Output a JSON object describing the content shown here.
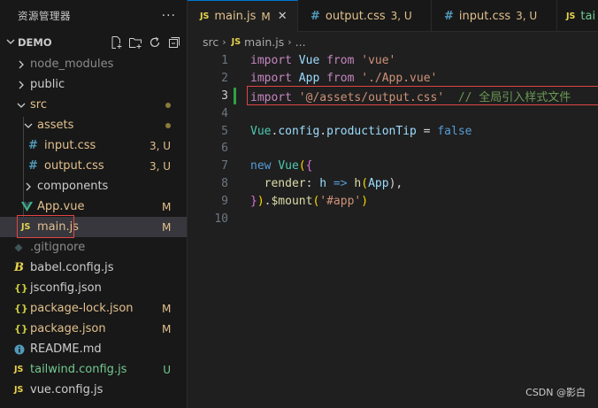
{
  "sidebar": {
    "title": "资源管理器",
    "more_label": "···",
    "workspace": "DEMO",
    "items": [
      {
        "name": "node_modules",
        "type": "folder",
        "state": "collapsed",
        "color": "gray"
      },
      {
        "name": "public",
        "type": "folder",
        "state": "collapsed",
        "color": "white"
      },
      {
        "name": "src",
        "type": "folder",
        "state": "expanded",
        "color": "modified",
        "dot": true
      },
      {
        "name": "assets",
        "type": "folder",
        "state": "expanded",
        "color": "modified",
        "dot": true
      },
      {
        "name": "input.css",
        "type": "css",
        "color": "modified",
        "badge": "3, U"
      },
      {
        "name": "output.css",
        "type": "css",
        "color": "modified",
        "badge": "3, U"
      },
      {
        "name": "components",
        "type": "folder",
        "state": "collapsed",
        "color": "white"
      },
      {
        "name": "App.vue",
        "type": "vue",
        "color": "modified",
        "badge": "M"
      },
      {
        "name": "main.js",
        "type": "js",
        "color": "modified",
        "badge": "M",
        "selected": true
      },
      {
        "name": ".gitignore",
        "type": "git",
        "color": "gray"
      },
      {
        "name": "babel.config.js",
        "type": "babel",
        "color": "white"
      },
      {
        "name": "jsconfig.json",
        "type": "json",
        "color": "white"
      },
      {
        "name": "package-lock.json",
        "type": "json",
        "color": "modified",
        "badge": "M"
      },
      {
        "name": "package.json",
        "type": "json",
        "color": "modified",
        "badge": "M"
      },
      {
        "name": "README.md",
        "type": "info",
        "color": "white"
      },
      {
        "name": "tailwind.config.js",
        "type": "js",
        "color": "untracked",
        "badge": "U"
      },
      {
        "name": "vue.config.js",
        "type": "js",
        "color": "white"
      }
    ]
  },
  "tabs": [
    {
      "icon": "JS",
      "label": "main.js",
      "status": "M",
      "close": "✕",
      "active": true
    },
    {
      "icon": "#",
      "label": "output.css",
      "status": "3, U",
      "active": false
    },
    {
      "icon": "#",
      "label": "input.css",
      "status": "3, U",
      "active": false
    },
    {
      "icon": "JS",
      "label": "tai",
      "status": "",
      "active": false
    }
  ],
  "breadcrumb": [
    "src",
    "main.js",
    "..."
  ],
  "code": {
    "current_line": 3,
    "line_numbers": [
      "1",
      "2",
      "3",
      "4",
      "5",
      "6",
      "7",
      "8",
      "9",
      "10"
    ],
    "l1": [
      "import",
      "Vue",
      "from",
      "'vue'"
    ],
    "l2": [
      "import",
      "App",
      "from",
      "'./App.vue'"
    ],
    "l3": [
      "import",
      "'@/assets/output.css'",
      "// 全局引入样式文件"
    ],
    "l5": [
      "Vue",
      ".",
      "config",
      ".",
      "productionTip",
      " = ",
      "false"
    ],
    "l7": [
      "new",
      "Vue",
      "(",
      "{"
    ],
    "l8": [
      "render",
      ": ",
      "h",
      " => ",
      "h",
      "(",
      "App",
      "),"
    ],
    "l9": [
      "}",
      ")",
      ".",
      "$mount",
      "(",
      "'#app'",
      ")"
    ]
  },
  "watermark": "CSDN @影白",
  "colors": {
    "modified": "#e2c08d",
    "untracked": "#73c991",
    "accent": "#0078d4",
    "highlight_box": "#e04545"
  }
}
